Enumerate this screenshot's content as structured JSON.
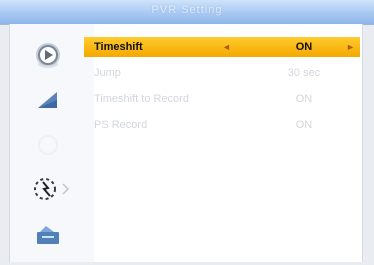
{
  "window": {
    "title": "PVR Setting"
  },
  "sidebar": {
    "icons": [
      {
        "name": "play-icon"
      },
      {
        "name": "signal-bars-icon"
      },
      {
        "name": "blank-circle-icon"
      },
      {
        "name": "gear-settings-icon"
      },
      {
        "name": "media-card-icon"
      }
    ]
  },
  "menu": {
    "items": [
      {
        "label": "Timeshift",
        "value": "ON",
        "selected": true
      },
      {
        "label": "Jump",
        "value": "30 sec"
      },
      {
        "label": "Timeshift to Record",
        "value": "ON"
      },
      {
        "label": "PS Record",
        "value": "ON"
      }
    ]
  },
  "colors": {
    "highlight": "#f7b500",
    "title_bar": "#a9c9f2",
    "dim_text": "#d2d6dc"
  }
}
